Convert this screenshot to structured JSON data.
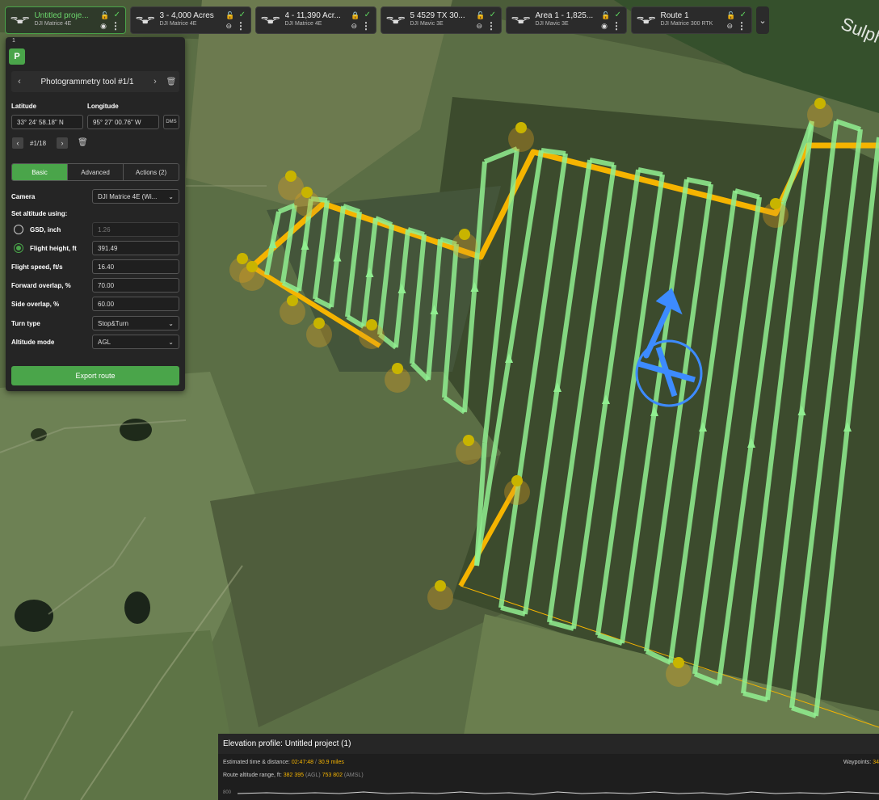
{
  "map": {
    "place_label": "Sulph",
    "colors": {
      "lane": "#90ee90",
      "boundary": "#f5b400",
      "waypoint": "#c8b400",
      "home": "#3d8bff"
    }
  },
  "tabs": [
    {
      "title": "Untitled proje...",
      "subtitle": "DJI Matrice 4E",
      "active": true,
      "lock_icon": "lock-open-icon",
      "lock_color": "white",
      "view_icon": "eye-icon"
    },
    {
      "title": "3 - 4,000 Acres",
      "subtitle": "DJI Matrice 4E",
      "active": false,
      "lock_icon": "lock-open-icon",
      "lock_color": "white",
      "view_icon": "eye-off-icon"
    },
    {
      "title": "4 - 11,390 Acr...",
      "subtitle": "DJI Matrice 4E",
      "active": false,
      "lock_icon": "lock-icon",
      "lock_color": "yellow",
      "view_icon": "eye-off-icon"
    },
    {
      "title": "5 4529 TX 30...",
      "subtitle": "DJI Mavic 3E",
      "active": false,
      "lock_icon": "lock-open-icon",
      "lock_color": "white",
      "view_icon": "eye-off-icon"
    },
    {
      "title": "Area 1 - 1,825...",
      "subtitle": "DJI Mavic 3E",
      "active": false,
      "lock_icon": "lock-open-icon",
      "lock_color": "white",
      "view_icon": "eye-icon"
    },
    {
      "title": "Route 1",
      "subtitle": "DJI Matrice 300 RTK",
      "active": false,
      "lock_icon": "lock-open-icon",
      "lock_color": "white",
      "view_icon": "eye-off-icon"
    }
  ],
  "panel": {
    "number": "1",
    "title": "Photogrammetry tool #1/1",
    "latitude_label": "Latitude",
    "longitude_label": "Longitude",
    "latitude": "33° 24' 58.18\" N",
    "longitude": "95° 27' 00.76\" W",
    "dms": "DMS",
    "waypoint_index": "#1/18",
    "tabs": [
      "Basic",
      "Advanced",
      "Actions (2)"
    ],
    "camera_label": "Camera",
    "camera_value": "DJI Matrice 4E (Wi...",
    "altitude_using_label": "Set altitude using:",
    "gsd_label": "GSD, inch",
    "gsd_value": "1.26",
    "flight_height_label": "Flight height, ft",
    "flight_height_value": "391.49",
    "flight_speed_label": "Flight speed, ft/s",
    "flight_speed_value": "16.40",
    "forward_overlap_label": "Forward overlap, %",
    "forward_overlap_value": "70.00",
    "side_overlap_label": "Side overlap, %",
    "side_overlap_value": "60.00",
    "turn_type_label": "Turn type",
    "turn_type_value": "Stop&Turn",
    "altitude_mode_label": "Altitude mode",
    "altitude_mode_value": "AGL",
    "export_label": "Export route"
  },
  "elevation": {
    "title": "Elevation profile: Untitled project (1)",
    "time_distance_label": "Estimated time & distance:",
    "time": "02:47:48",
    "slash": "/",
    "distance": "30.9 miles",
    "range_label": "Route altitude range, ft:",
    "agl_min": "382",
    "agl_max": "395",
    "agl": "(AGL)",
    "amsl_min": "753",
    "amsl_max": "802",
    "amsl": "(AMSL)",
    "waypoints_label": "Waypoints:",
    "waypoints_value": "34",
    "axis_tick": "800"
  }
}
